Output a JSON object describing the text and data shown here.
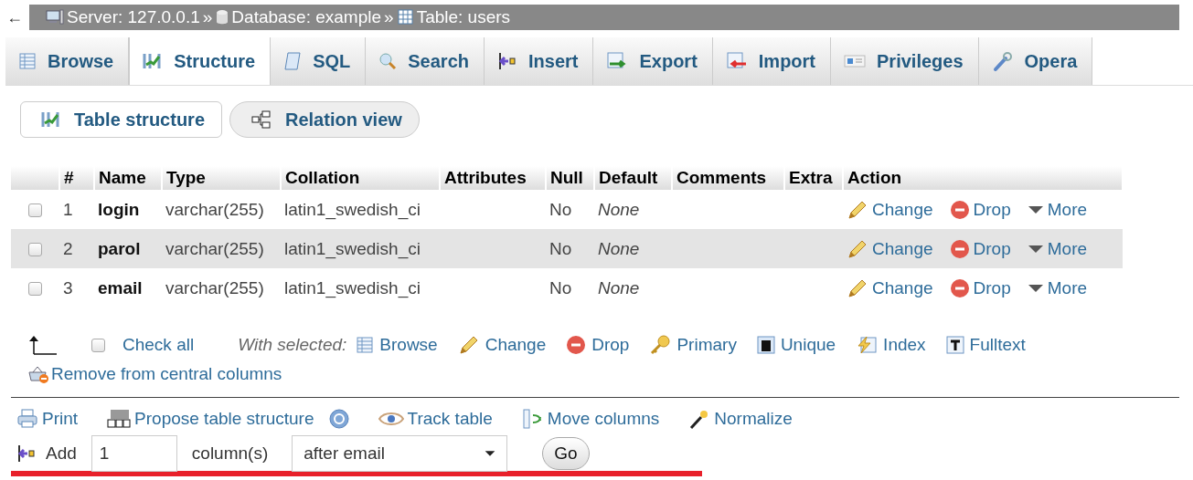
{
  "breadcrumb": {
    "back": "←",
    "items": [
      {
        "label": "Server: 127.0.0.1",
        "separator": "»"
      },
      {
        "label": "Database: example",
        "separator": "»"
      },
      {
        "label": "Table: users"
      }
    ]
  },
  "tabs": [
    {
      "label": "Browse",
      "selected": false
    },
    {
      "label": "Structure",
      "selected": true
    },
    {
      "label": "SQL",
      "selected": false
    },
    {
      "label": "Search",
      "selected": false
    },
    {
      "label": "Insert",
      "selected": false
    },
    {
      "label": "Export",
      "selected": false
    },
    {
      "label": "Import",
      "selected": false
    },
    {
      "label": "Privileges",
      "selected": false
    },
    {
      "label": "Opera",
      "selected": false
    }
  ],
  "subtabs": [
    {
      "label": "Table structure",
      "selected": true
    },
    {
      "label": "Relation view",
      "selected": false
    }
  ],
  "table": {
    "columns": [
      "#",
      "Name",
      "Type",
      "Collation",
      "Attributes",
      "Null",
      "Default",
      "Comments",
      "Extra",
      "Action"
    ],
    "rows": [
      {
        "checked": false,
        "number": "1",
        "name": "login",
        "type": "varchar(255)",
        "collation": "latin1_swedish_ci",
        "null": "No",
        "default": "None",
        "change": "Change",
        "drop": "Drop",
        "more": "More"
      },
      {
        "checked": false,
        "number": "2",
        "name": "parol",
        "type": "varchar(255)",
        "collation": "latin1_swedish_ci",
        "null": "No",
        "default": "None",
        "change": "Change",
        "drop": "Drop",
        "more": "More"
      },
      {
        "checked": false,
        "number": "3",
        "name": "email",
        "type": "varchar(255)",
        "collation": "latin1_swedish_ci",
        "null": "No",
        "default": "None",
        "change": "Change",
        "drop": "Drop",
        "more": "More"
      }
    ]
  },
  "bulk": {
    "check_all": {
      "label": "Check all",
      "checked": false
    },
    "with_selected": "With selected:",
    "actions": [
      "Browse",
      "Change",
      "Drop",
      "Primary",
      "Unique",
      "Index",
      "Fulltext"
    ],
    "remove": "Remove from central columns"
  },
  "tools": {
    "links": [
      "Print",
      "Propose table structure",
      "Track table",
      "Move columns",
      "Normalize"
    ],
    "add": {
      "label": "Add",
      "count": "1",
      "unit": "column(s)",
      "position": "after email",
      "go": "Go"
    }
  }
}
